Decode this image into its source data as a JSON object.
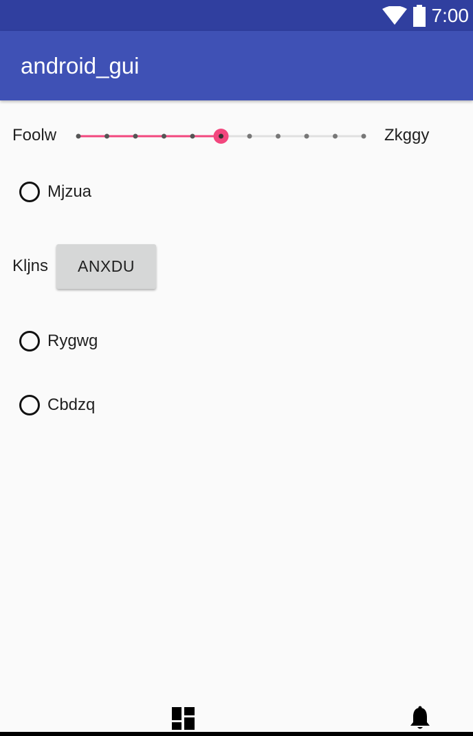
{
  "status_bar": {
    "time": "7:00",
    "icons": [
      "wifi-icon",
      "battery-icon"
    ]
  },
  "app_bar": {
    "title": "android_gui"
  },
  "slider": {
    "min_label": "Foolw",
    "max_label": "Zkggy",
    "steps": 10,
    "value": 5,
    "accent": "#f2477e"
  },
  "radios": [
    {
      "label": "Mjzua"
    },
    {
      "label": "Rygwg"
    },
    {
      "label": "Cbdzq"
    }
  ],
  "button_row": {
    "label": "Kljns",
    "button": "ANXDU"
  },
  "bottom_icons": [
    "dashboard-icon",
    "notifications-icon"
  ],
  "colors": {
    "status_bar": "#303f9f",
    "app_bar": "#3f51b5",
    "background": "#fafafa"
  }
}
